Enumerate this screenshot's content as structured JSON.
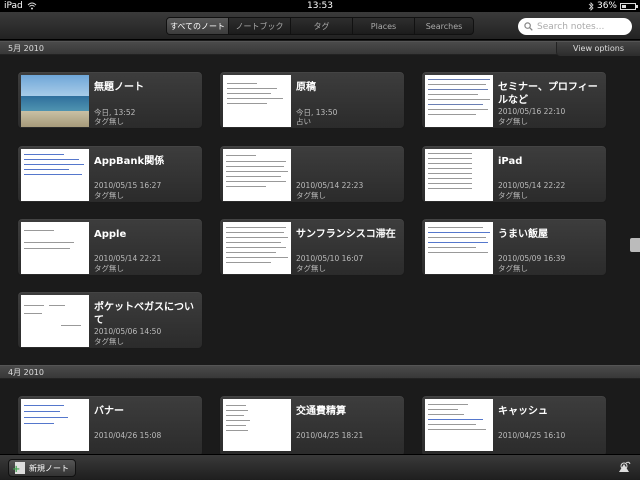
{
  "status_bar": {
    "device": "iPad",
    "time": "13:53",
    "battery": "36%",
    "battery_level": 0.36
  },
  "toolbar": {
    "tabs": [
      {
        "label": "すべてのノート"
      },
      {
        "label": "ノートブック"
      },
      {
        "label": "タグ"
      },
      {
        "label": "Places"
      },
      {
        "label": "Searches"
      }
    ],
    "active_tab": 0,
    "search": {
      "placeholder": "Search notes..."
    }
  },
  "sections": [
    {
      "label": "5月 2010",
      "view_options": "View options"
    },
    {
      "label": "4月 2010"
    }
  ],
  "notes": [
    {
      "title": "無題ノート",
      "date": "今日, 13:52",
      "tag": "タグ無し"
    },
    {
      "title": "原稿",
      "date": "今日, 13:50",
      "tag": "占い"
    },
    {
      "title": "セミナー、プロフィールなど",
      "date": "2010/05/16 22:10",
      "tag": "タグ無し"
    },
    {
      "title": "AppBank関係",
      "date": "2010/05/15 16:27",
      "tag": "タグ無し"
    },
    {
      "title": "",
      "date": "2010/05/14 22:23",
      "tag": "タグ無し"
    },
    {
      "title": "iPad",
      "date": "2010/05/14 22:22",
      "tag": "タグ無し"
    },
    {
      "title": "Apple",
      "date": "2010/05/14 22:21",
      "tag": "タグ無し"
    },
    {
      "title": "サンフランシスコ滞在",
      "date": "2010/05/10 16:07",
      "tag": "タグ無し"
    },
    {
      "title": "うまい飯屋",
      "date": "2010/05/09 16:39",
      "tag": "タグ無し"
    },
    {
      "title": "ポケットベガスについて",
      "date": "2010/05/06 14:50",
      "tag": "タグ無し"
    },
    {
      "title": "バナー",
      "date": "2010/04/26 15:08",
      "tag": ""
    },
    {
      "title": "交通費精算",
      "date": "2010/04/25 18:21",
      "tag": ""
    },
    {
      "title": "キャッシュ",
      "date": "2010/04/25 16:10",
      "tag": ""
    }
  ],
  "bottom_bar": {
    "new_note_label": "新規ノート"
  },
  "icons": {
    "wifi": "wifi-icon",
    "bluetooth": "bluetooth-icon",
    "battery": "battery-icon",
    "search": "search-icon",
    "new_note": "new-note-icon",
    "sync": "sync-icon"
  }
}
